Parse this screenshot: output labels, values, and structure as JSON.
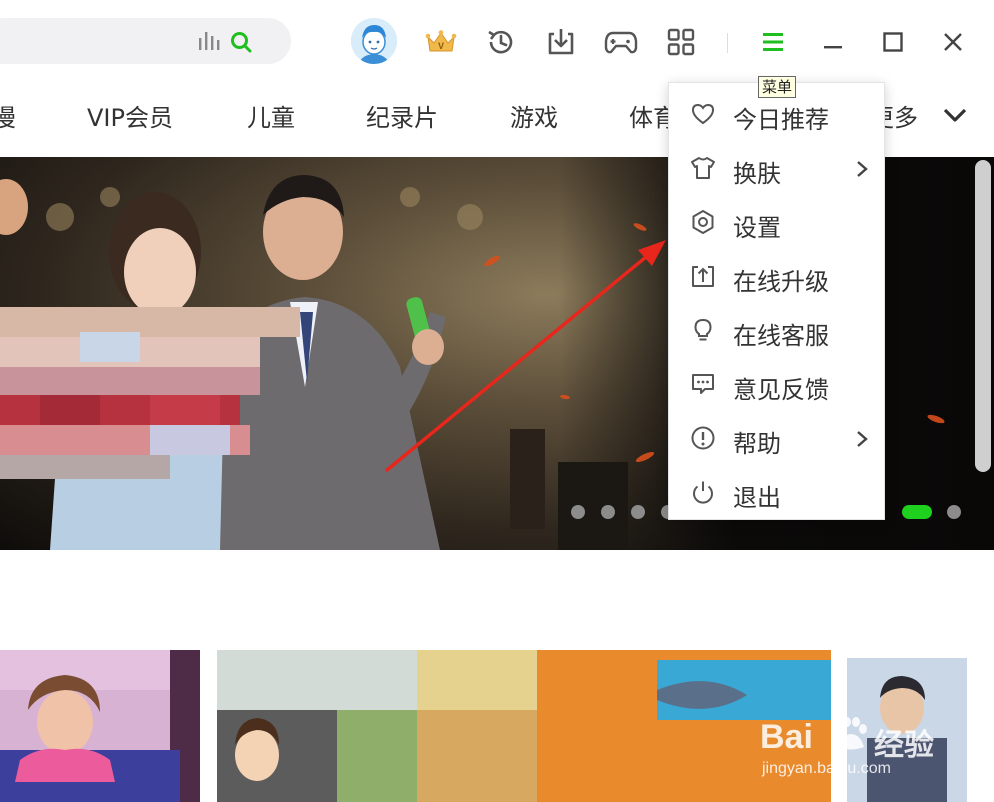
{
  "header": {
    "search_placeholder": "",
    "tooltip": "菜单"
  },
  "nav": {
    "items": [
      "漫",
      "VIP会员",
      "儿童",
      "纪录片",
      "游戏",
      "体育",
      "更多"
    ]
  },
  "menu": {
    "items": [
      {
        "label": "今日推荐",
        "icon": "heart-icon",
        "submenu": false
      },
      {
        "label": "换肤",
        "icon": "shirt-icon",
        "submenu": true
      },
      {
        "label": "设置",
        "icon": "gear-icon",
        "submenu": false
      },
      {
        "label": "在线升级",
        "icon": "upgrade-icon",
        "submenu": false
      },
      {
        "label": "在线客服",
        "icon": "lightbulb-icon",
        "submenu": false
      },
      {
        "label": "意见反馈",
        "icon": "feedback-icon",
        "submenu": false
      },
      {
        "label": "帮助",
        "icon": "help-icon",
        "submenu": true
      },
      {
        "label": "退出",
        "icon": "power-icon",
        "submenu": false
      }
    ]
  },
  "carousel": {
    "total": 14,
    "active_index": 11
  },
  "watermark": {
    "brand": "Bai",
    "brand_cn": "经验",
    "url": "jingyan.baidu.com"
  },
  "colors": {
    "accent": "#1fd11f",
    "arrow": "#e8261c",
    "text": "#333333"
  }
}
